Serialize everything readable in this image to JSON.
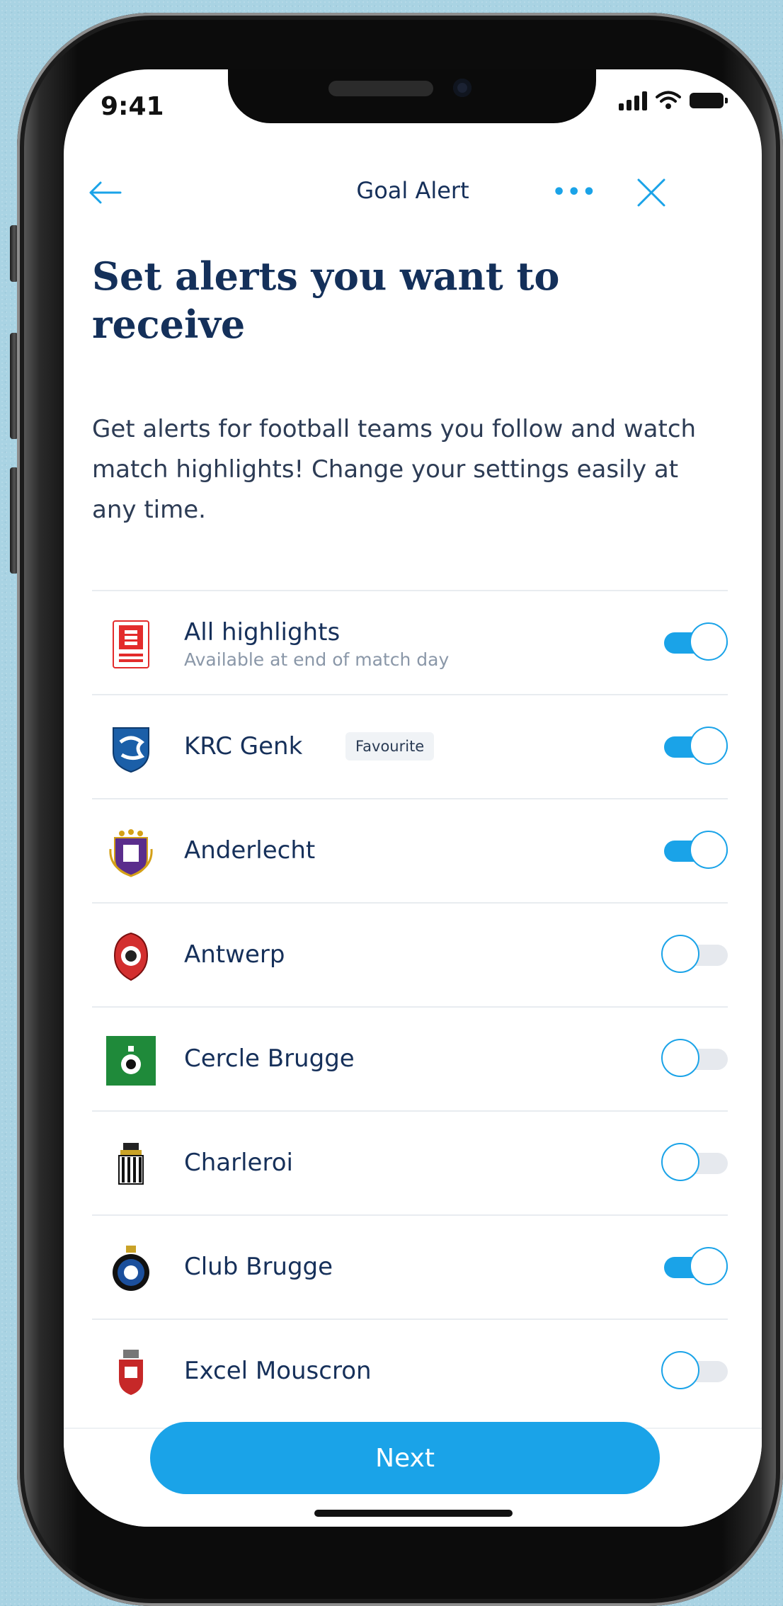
{
  "status_bar": {
    "time": "9:41"
  },
  "nav": {
    "title": "Goal Alert",
    "more": "•••"
  },
  "heading": "Set alerts you want to receive",
  "description": "Get alerts for football teams you follow and watch match highlights! Change your settings easily at any time.",
  "alerts": [
    {
      "name": "All highlights",
      "subtitle": "Available at end of match day",
      "badge": "",
      "enabled": true,
      "logo": "eleven-sports-logo"
    },
    {
      "name": "KRC Genk",
      "subtitle": "",
      "badge": "Favourite",
      "enabled": true,
      "logo": "krc-genk-crest"
    },
    {
      "name": "Anderlecht",
      "subtitle": "",
      "badge": "",
      "enabled": true,
      "logo": "anderlecht-crest"
    },
    {
      "name": "Antwerp",
      "subtitle": "",
      "badge": "",
      "enabled": false,
      "logo": "antwerp-crest"
    },
    {
      "name": "Cercle Brugge",
      "subtitle": "",
      "badge": "",
      "enabled": false,
      "logo": "cercle-brugge-crest"
    },
    {
      "name": "Charleroi",
      "subtitle": "",
      "badge": "",
      "enabled": false,
      "logo": "charleroi-crest"
    },
    {
      "name": "Club Brugge",
      "subtitle": "",
      "badge": "",
      "enabled": true,
      "logo": "club-brugge-crest"
    },
    {
      "name": "Excel Mouscron",
      "subtitle": "",
      "badge": "",
      "enabled": false,
      "logo": "mouscron-crest"
    }
  ],
  "next_label": "Next",
  "colors": {
    "accent": "#1aa3e8",
    "heading": "#14305a",
    "background": "#a9d3e3"
  }
}
